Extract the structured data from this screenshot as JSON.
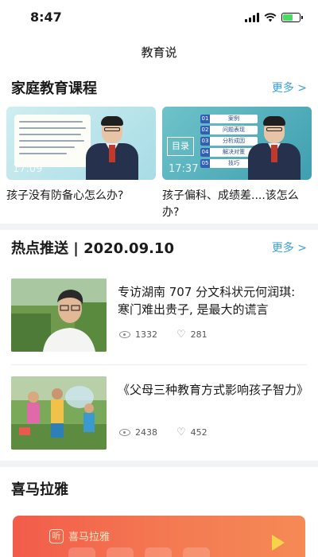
{
  "status_bar": {
    "time": "8:47"
  },
  "nav": {
    "title": "教育说"
  },
  "courses_section": {
    "title": "家庭教育课程",
    "more": "更多 >",
    "items": [
      {
        "caption": "孩子没有防备心怎么办?",
        "duration": "17:09"
      },
      {
        "caption": "孩子偏科、成绩差....该怎么办?",
        "duration": "17:37"
      }
    ],
    "toc": {
      "label": "目录",
      "rows": [
        {
          "num": "01",
          "text": "案例"
        },
        {
          "num": "02",
          "text": "问题表现"
        },
        {
          "num": "03",
          "text": "分析成因"
        },
        {
          "num": "04",
          "text": "解决对策"
        },
        {
          "num": "05",
          "text": "技巧"
        }
      ]
    }
  },
  "hot_section": {
    "title": "热点推送 | 2020.09.10",
    "more": "更多 >",
    "items": [
      {
        "title": "专访湖南 707 分文科状元何润琪: 寒门难出贵子, 是最大的谎言",
        "views": "1332",
        "likes": "281"
      },
      {
        "title": "《父母三种教育方式影响孩子智力》",
        "views": "2438",
        "likes": "452"
      }
    ]
  },
  "himalaya_section": {
    "title": "喜马拉雅",
    "banner_logo_mark": "听",
    "banner_logo_text": "喜马拉雅"
  },
  "colors": {
    "accent": "#3aa0d8",
    "divider": "#f2f3f5",
    "banner": "#f25c4a"
  }
}
